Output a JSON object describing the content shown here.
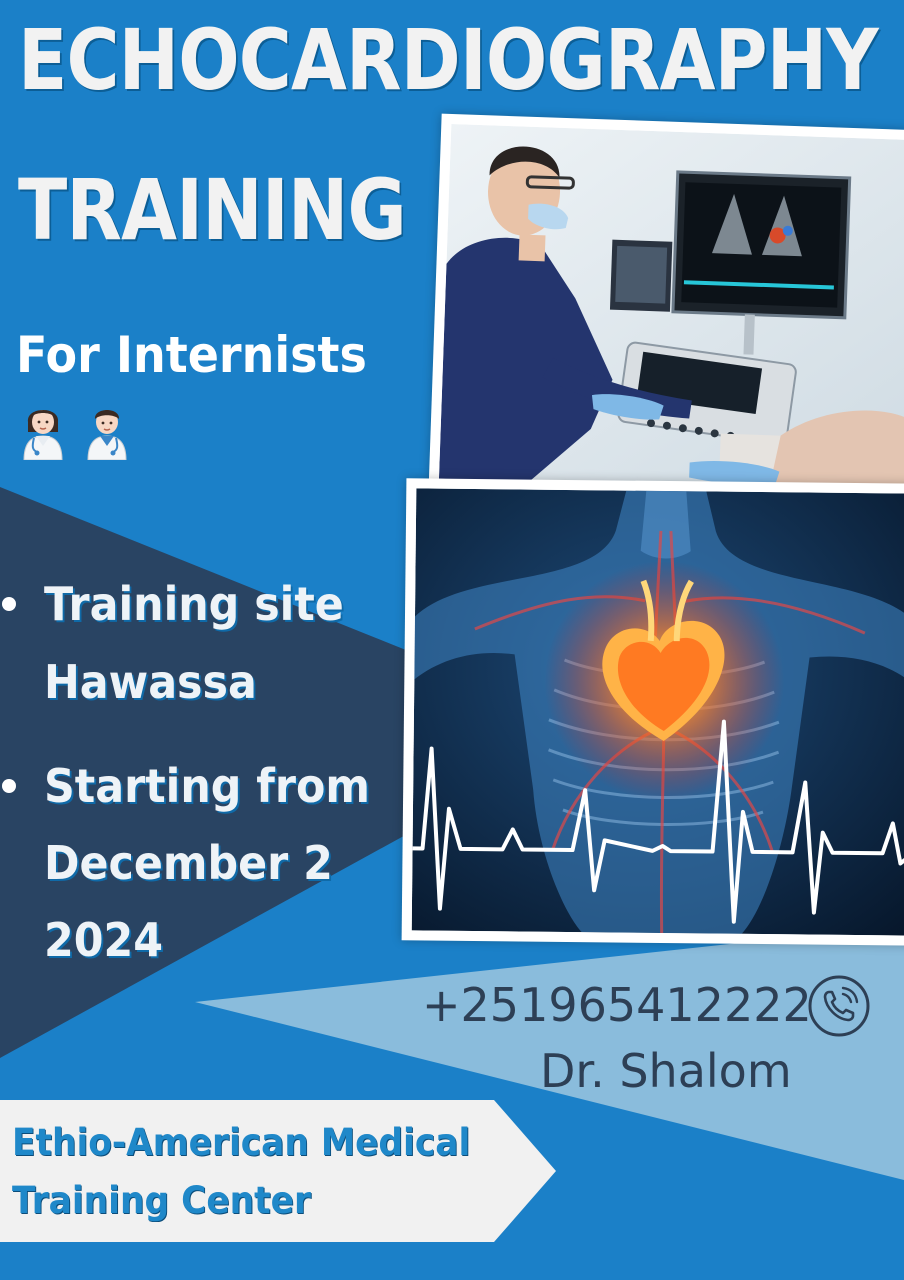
{
  "poster": {
    "title_lines": [
      "ECHOCARDIOGRAPHY",
      "TRAINING"
    ],
    "subtitle": "For Internists",
    "emoji_icons": [
      "woman-health-worker-icon",
      "man-health-worker-icon"
    ],
    "images": [
      {
        "name": "sonographer-at-ultrasound-machine-photo"
      },
      {
        "name": "heart-anatomy-ecg-illustration"
      }
    ],
    "bullets": [
      {
        "lines": [
          "Training site",
          "Hawassa"
        ]
      },
      {
        "lines": [
          "Starting from",
          "December 2",
          "2024"
        ]
      }
    ],
    "contact": {
      "phone": "+251965412222",
      "phone_icon": "phone-icon",
      "name": "Dr. Shalom"
    },
    "organization_lines": [
      "Ethio-American Medical",
      "Training Center"
    ],
    "colors": {
      "background_blue": "#1b80c8",
      "dark_navy_triangle": "#294463",
      "light_blue_band": "#8abcdc",
      "banner_bg": "#f1f1f1",
      "banner_text": "#1f88c9",
      "contact_text": "#2d3f55"
    }
  }
}
